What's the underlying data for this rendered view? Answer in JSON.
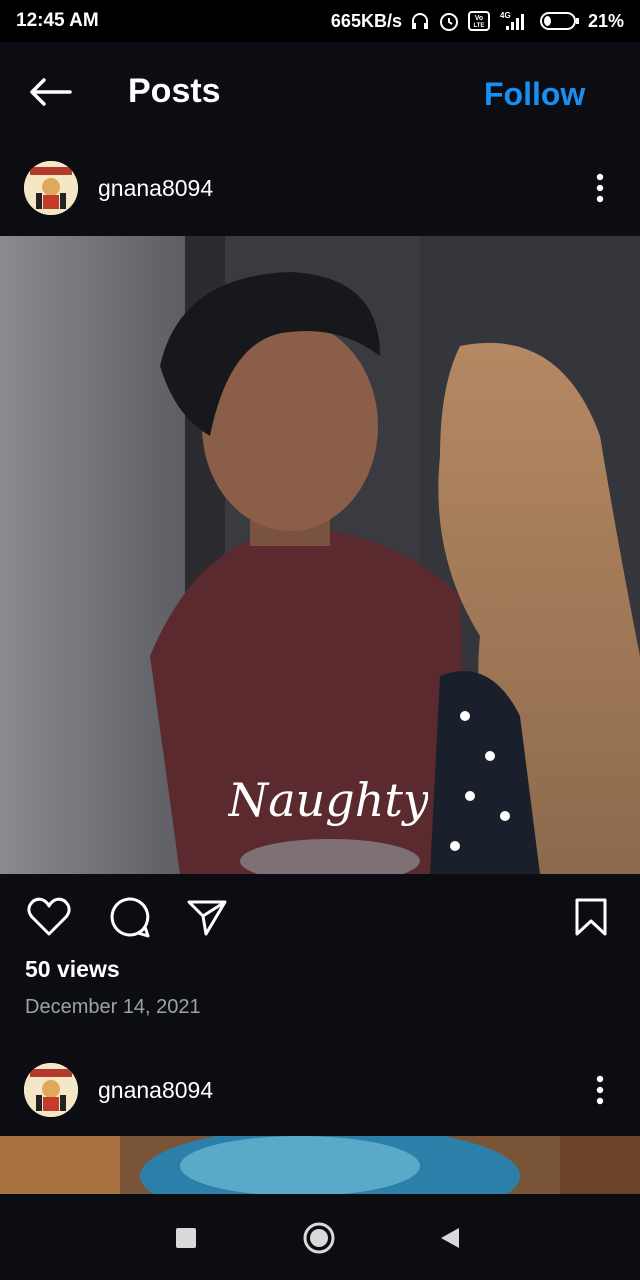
{
  "status_bar": {
    "time": "12:45 AM",
    "speed": "665KB/s",
    "battery": "21%",
    "icons": [
      "headphones-icon",
      "alarm-icon",
      "volte-icon",
      "signal-icon",
      "battery-icon"
    ]
  },
  "header": {
    "title": "Posts",
    "follow_label": "Follow",
    "back_icon": "back-arrow-icon"
  },
  "posts": [
    {
      "username": "gnana8094",
      "media_overlay_text": "Naughty",
      "views": "50 views",
      "date": "December 14, 2021"
    },
    {
      "username": "gnana8094"
    }
  ],
  "colors": {
    "background": "#0b0d12",
    "accent": "#1a8ff2",
    "muted": "#9ea1a8"
  }
}
